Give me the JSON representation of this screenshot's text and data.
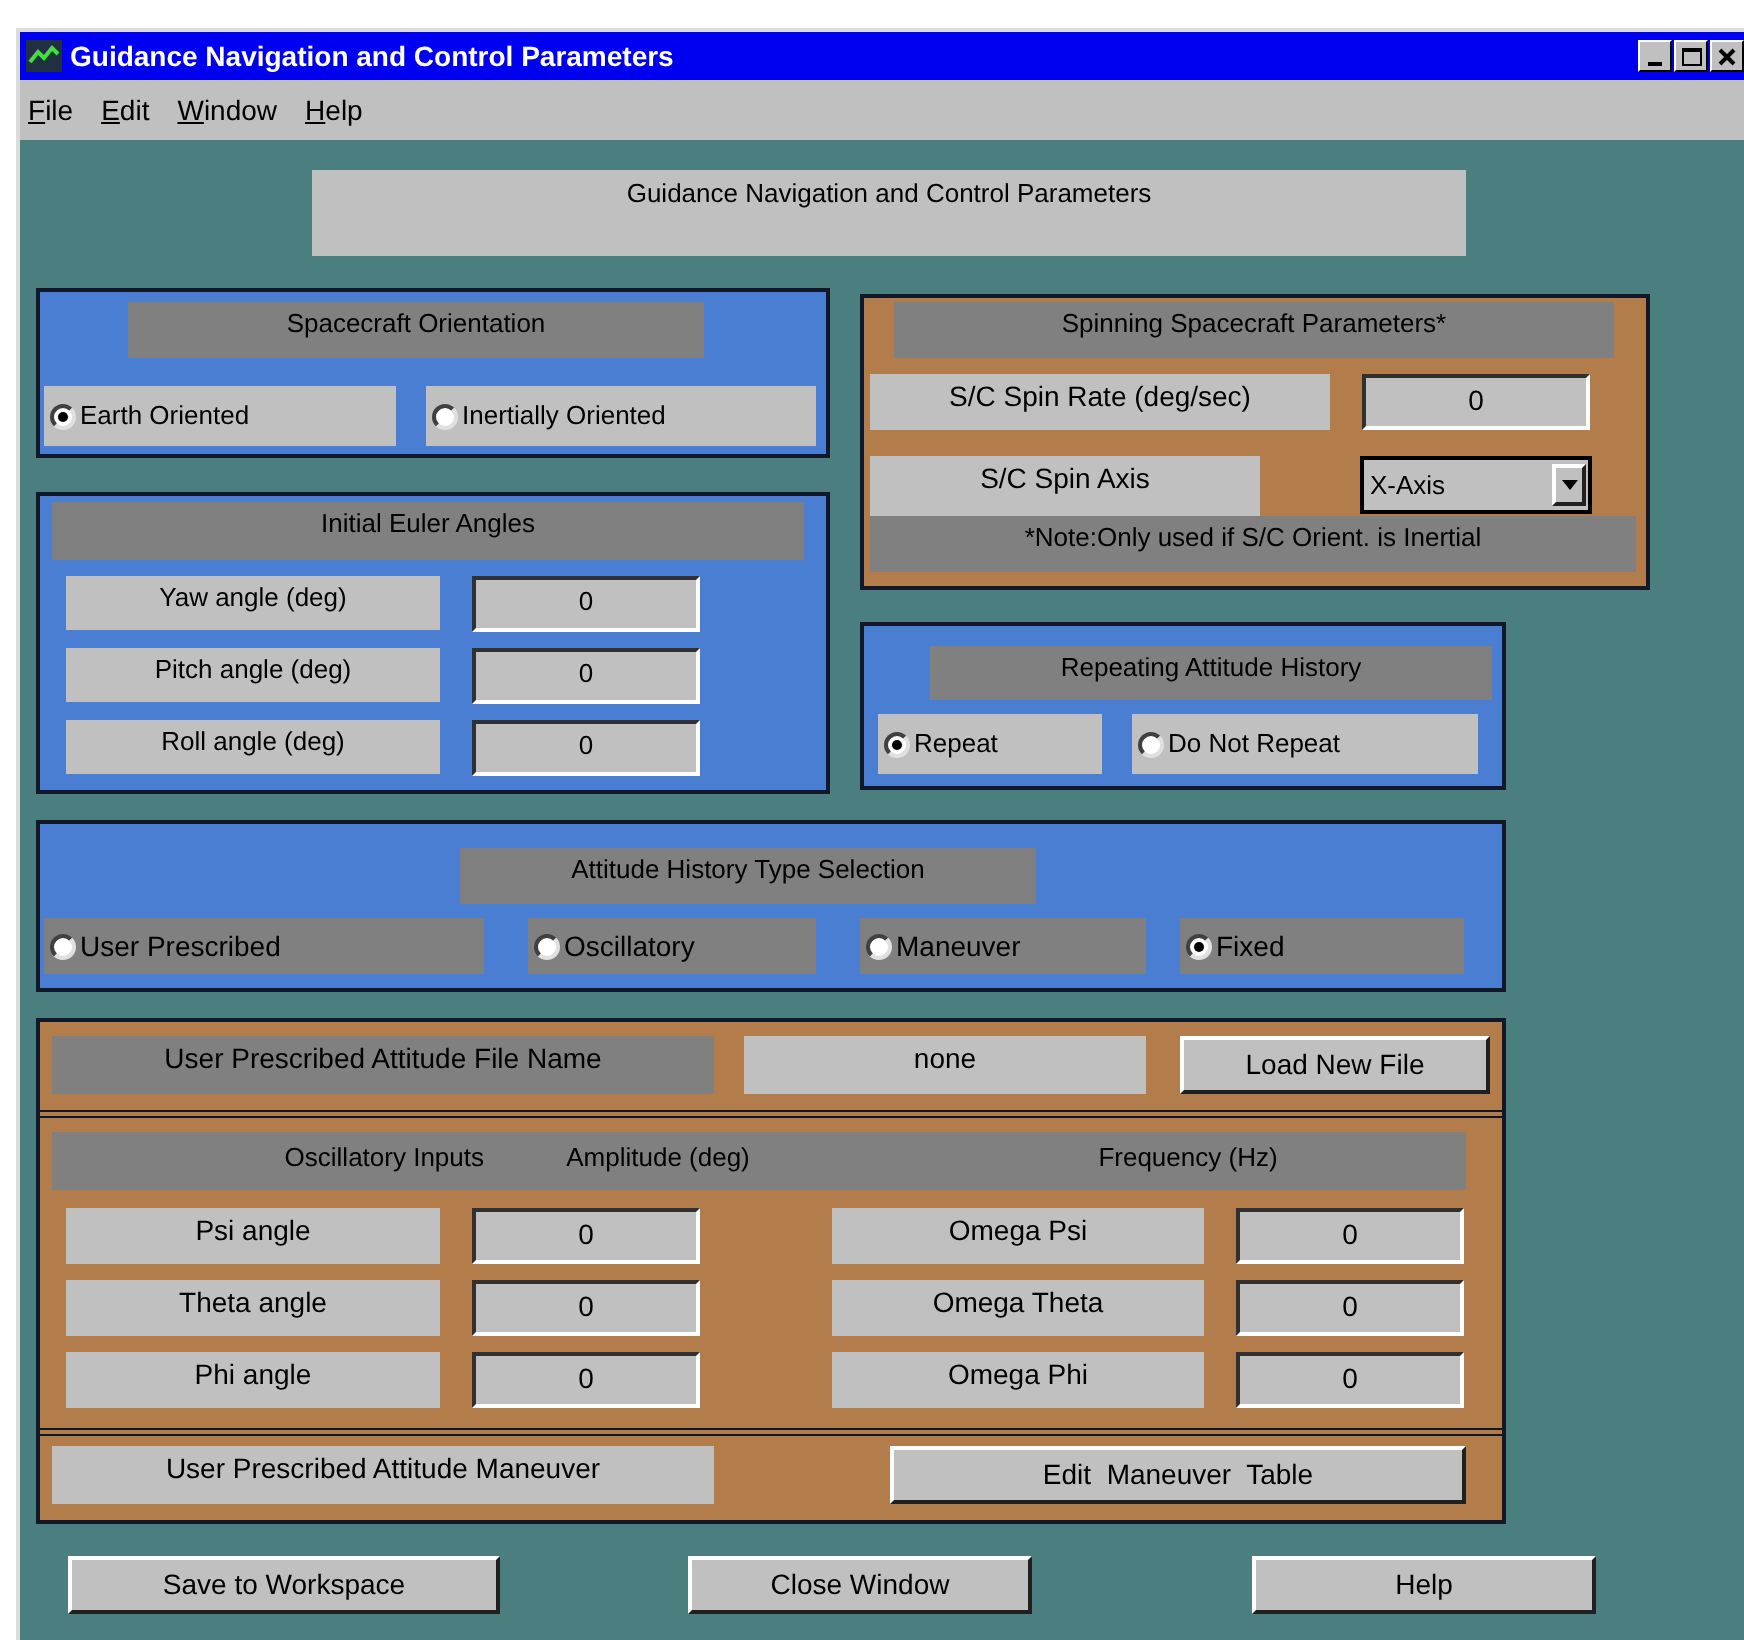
{
  "window": {
    "title": "Guidance Navigation and Control Parameters"
  },
  "menu": [
    {
      "label": "File"
    },
    {
      "label": "Edit"
    },
    {
      "label": "Window"
    },
    {
      "label": "Help"
    }
  ],
  "header": "Guidance Navigation and Control Parameters",
  "orientation": {
    "title": "Spacecraft Orientation",
    "options": [
      {
        "label": "Earth Oriented",
        "selected": true
      },
      {
        "label": "Inertially Oriented",
        "selected": false
      }
    ]
  },
  "euler": {
    "title": "Initial Euler Angles",
    "rows": [
      {
        "label": "Yaw angle (deg)",
        "value": "0"
      },
      {
        "label": "Pitch angle (deg)",
        "value": "0"
      },
      {
        "label": "Roll angle (deg)",
        "value": "0"
      }
    ]
  },
  "spin": {
    "title": "Spinning Spacecraft Parameters*",
    "rate_label": "S/C Spin Rate (deg/sec)",
    "rate_value": "0",
    "axis_label": "S/C Spin Axis",
    "axis_value": "X-Axis",
    "note": "*Note:Only used if S/C Orient. is Inertial"
  },
  "repeat": {
    "title": "Repeating Attitude History",
    "options": [
      {
        "label": "Repeat",
        "selected": true
      },
      {
        "label": "Do Not Repeat",
        "selected": false
      }
    ]
  },
  "attitude_type": {
    "title": "Attitude History Type Selection",
    "options": [
      {
        "label": "User Prescribed",
        "selected": false
      },
      {
        "label": "Oscillatory",
        "selected": false
      },
      {
        "label": "Maneuver",
        "selected": false
      },
      {
        "label": "Fixed",
        "selected": true
      }
    ]
  },
  "file": {
    "label": "User Prescribed Attitude File Name",
    "value": "none",
    "button": "Load New File"
  },
  "oscillatory": {
    "headers": [
      "Oscillatory Inputs",
      "Amplitude (deg)",
      "Frequency (Hz)"
    ],
    "rows": [
      {
        "label": "Psi angle",
        "value": "0",
        "freq_label": "Omega Psi",
        "freq_value": "0"
      },
      {
        "label": "Theta angle",
        "value": "0",
        "freq_label": "Omega Theta",
        "freq_value": "0"
      },
      {
        "label": "Phi angle",
        "value": "0",
        "freq_label": "Omega Phi",
        "freq_value": "0"
      }
    ]
  },
  "maneuver": {
    "label": "User Prescribed Attitude Maneuver",
    "button": "Edit  Maneuver  Table"
  },
  "buttons": [
    "Save to Workspace",
    "Close Window",
    "Help"
  ]
}
